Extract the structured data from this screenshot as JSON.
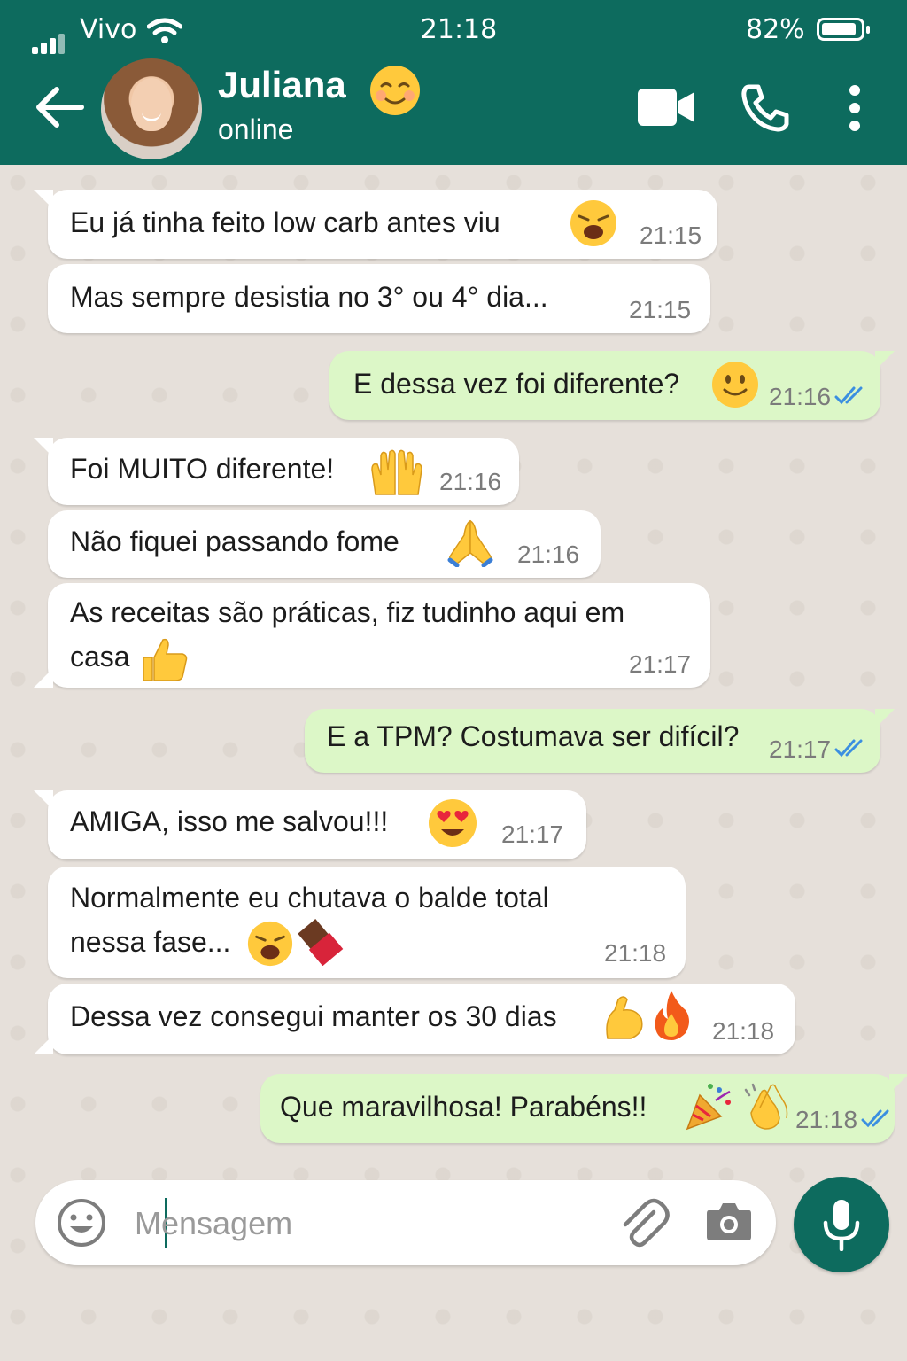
{
  "status_bar": {
    "carrier": "Vivo",
    "time": "21:18",
    "battery": "82%"
  },
  "header": {
    "contact_name": "Juliana",
    "contact_status": "online"
  },
  "messages": [
    {
      "text": "Eu já tinha feito low carb antes viu",
      "time": "21:15",
      "dir": "in"
    },
    {
      "text": "Mas sempre desistia no 3° ou 4° dia...",
      "time": "21:15",
      "dir": "in"
    },
    {
      "text": "E dessa vez foi diferente?",
      "time": "21:16",
      "dir": "out"
    },
    {
      "text": "Foi MUITO diferente!",
      "time": "21:16",
      "dir": "in"
    },
    {
      "text": "Não fiquei passando fome",
      "time": "21:16",
      "dir": "in"
    },
    {
      "text": "As receitas são práticas, fiz tudinho aqui em",
      "text2": "casa",
      "time": "21:17",
      "dir": "in"
    },
    {
      "text": "E a TPM? Costumava ser difícil?",
      "time": "21:17",
      "dir": "out"
    },
    {
      "text": "AMIGA, isso me salvou!!!",
      "time": "21:17",
      "dir": "in"
    },
    {
      "text": "Normalmente eu chutava o balde total",
      "text2": "nessa fase...",
      "time": "21:18",
      "dir": "in"
    },
    {
      "text": "Dessa vez consegui manter os 30 dias",
      "time": "21:18",
      "dir": "in"
    },
    {
      "text": "Que maravilhosa! Parabéns!!",
      "time": "21:18",
      "dir": "out"
    }
  ],
  "input": {
    "placeholder": "Mensagem"
  },
  "colors": {
    "header": "#0d6b5e",
    "outgoing_bubble": "#dcf7c7",
    "incoming_bubble": "#ffffff",
    "read_ticks": "#3b8fe0"
  },
  "icons": [
    "back-arrow-icon",
    "video-call-icon",
    "phone-icon",
    "more-options-icon",
    "emoji-icon",
    "attach-icon",
    "camera-icon",
    "mic-icon"
  ]
}
